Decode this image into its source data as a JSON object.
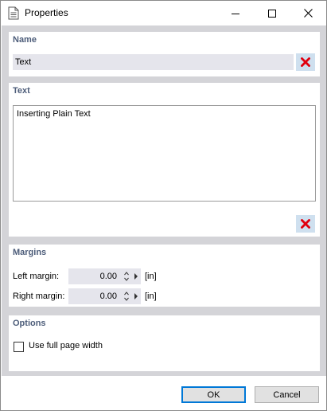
{
  "window": {
    "title": "Properties"
  },
  "name_section": {
    "title": "Name",
    "value": "Text"
  },
  "text_section": {
    "title": "Text",
    "value": "Inserting Plain Text"
  },
  "margins_section": {
    "title": "Margins",
    "left": {
      "label": "Left margin:",
      "value": "0.00",
      "unit": "[in]"
    },
    "right": {
      "label": "Right margin:",
      "value": "0.00",
      "unit": "[in]"
    }
  },
  "options_section": {
    "title": "Options",
    "full_width": {
      "label": "Use full page width",
      "checked": false
    }
  },
  "buttons": {
    "ok": "OK",
    "cancel": "Cancel"
  },
  "colors": {
    "clear_icon": "#e0000f",
    "section_title": "#4d5d7a",
    "client_bg": "#d4d4d8"
  }
}
